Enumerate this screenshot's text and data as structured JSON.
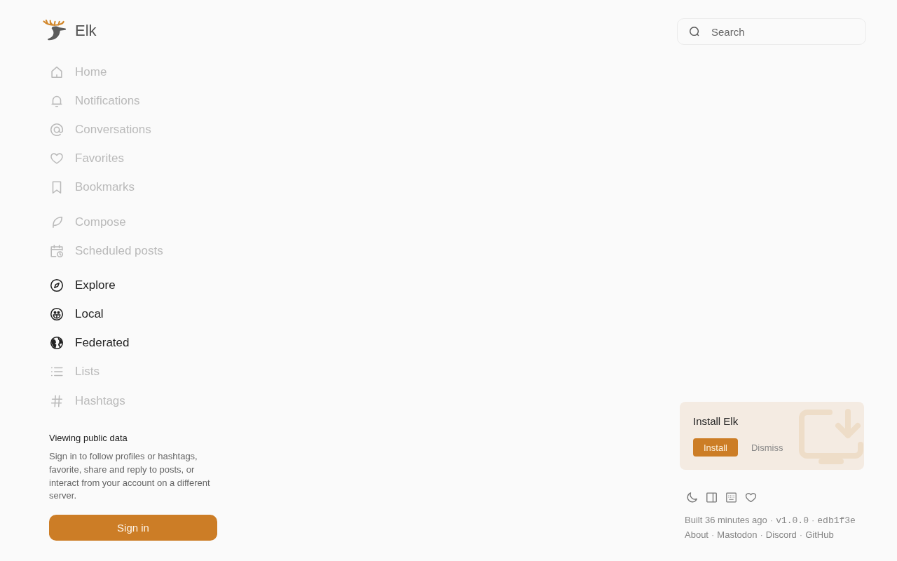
{
  "app": {
    "name": "Elk"
  },
  "search": {
    "placeholder": "Search"
  },
  "nav_groups": [
    {
      "items": [
        {
          "label": "Home",
          "disabled": true
        },
        {
          "label": "Notifications",
          "disabled": true
        },
        {
          "label": "Conversations",
          "disabled": true
        },
        {
          "label": "Favorites",
          "disabled": true
        },
        {
          "label": "Bookmarks",
          "disabled": true
        }
      ]
    },
    {
      "items": [
        {
          "label": "Compose",
          "disabled": true
        },
        {
          "label": "Scheduled posts",
          "disabled": true
        }
      ]
    },
    {
      "items": [
        {
          "label": "Explore",
          "disabled": false
        },
        {
          "label": "Local",
          "disabled": false
        },
        {
          "label": "Federated",
          "disabled": false
        },
        {
          "label": "Lists",
          "disabled": true
        },
        {
          "label": "Hashtags",
          "disabled": true
        }
      ]
    }
  ],
  "sign_in_panel": {
    "title": "Viewing public data",
    "text": "Sign in to follow profiles or hashtags, favorite, share and reply to posts, or interact from your account on a different server.",
    "button": "Sign in"
  },
  "install_card": {
    "title": "Install Elk",
    "buttons": [
      {
        "label": "Install",
        "kind": "primary"
      },
      {
        "label": "Dismiss",
        "kind": "secondary"
      }
    ]
  },
  "footer": {
    "build": [
      {
        "text": "Built 36 minutes ago",
        "kind": "text"
      },
      {
        "text": "·",
        "kind": "separator"
      },
      {
        "text": "v1.0.0",
        "kind": "version"
      },
      {
        "text": "·",
        "kind": "separator"
      },
      {
        "text": "edb1f3e",
        "kind": "commit"
      }
    ],
    "links": [
      {
        "text": "About",
        "kind": "link"
      },
      {
        "text": "·",
        "kind": "separator"
      },
      {
        "text": "Mastodon",
        "kind": "link"
      },
      {
        "text": "·",
        "kind": "separator"
      },
      {
        "text": "Discord",
        "kind": "link"
      },
      {
        "text": "·",
        "kind": "separator"
      },
      {
        "text": "GitHub",
        "kind": "link"
      }
    ]
  }
}
